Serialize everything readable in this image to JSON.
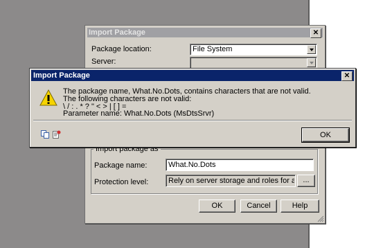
{
  "back_dialog": {
    "title": "Import Package",
    "package_location_label": "Package location:",
    "package_location_value": "File System",
    "server_label": "Server:",
    "server_value": "",
    "group_label": "Import package as",
    "package_name_label": "Package name:",
    "package_name_value": "What.No.Dots",
    "protection_label": "Protection level:",
    "protection_value": "Rely on server storage and roles for access control",
    "browse_label": "...",
    "ok_label": "OK",
    "cancel_label": "Cancel",
    "help_label": "Help"
  },
  "error_dialog": {
    "title": "Import Package",
    "icon": "warning-icon",
    "line1": "The package name, What.No.Dots, contains characters that are not valid.",
    "line2": "The following characters are not valid:",
    "line3": "\\ / : . * ? \" < > | [ ] =",
    "line4": "Parameter name: What.No.Dots (MsDtsSrvr)",
    "copy_icon": "copy-message-icon",
    "details_icon": "technical-details-icon",
    "ok_label": "OK"
  }
}
